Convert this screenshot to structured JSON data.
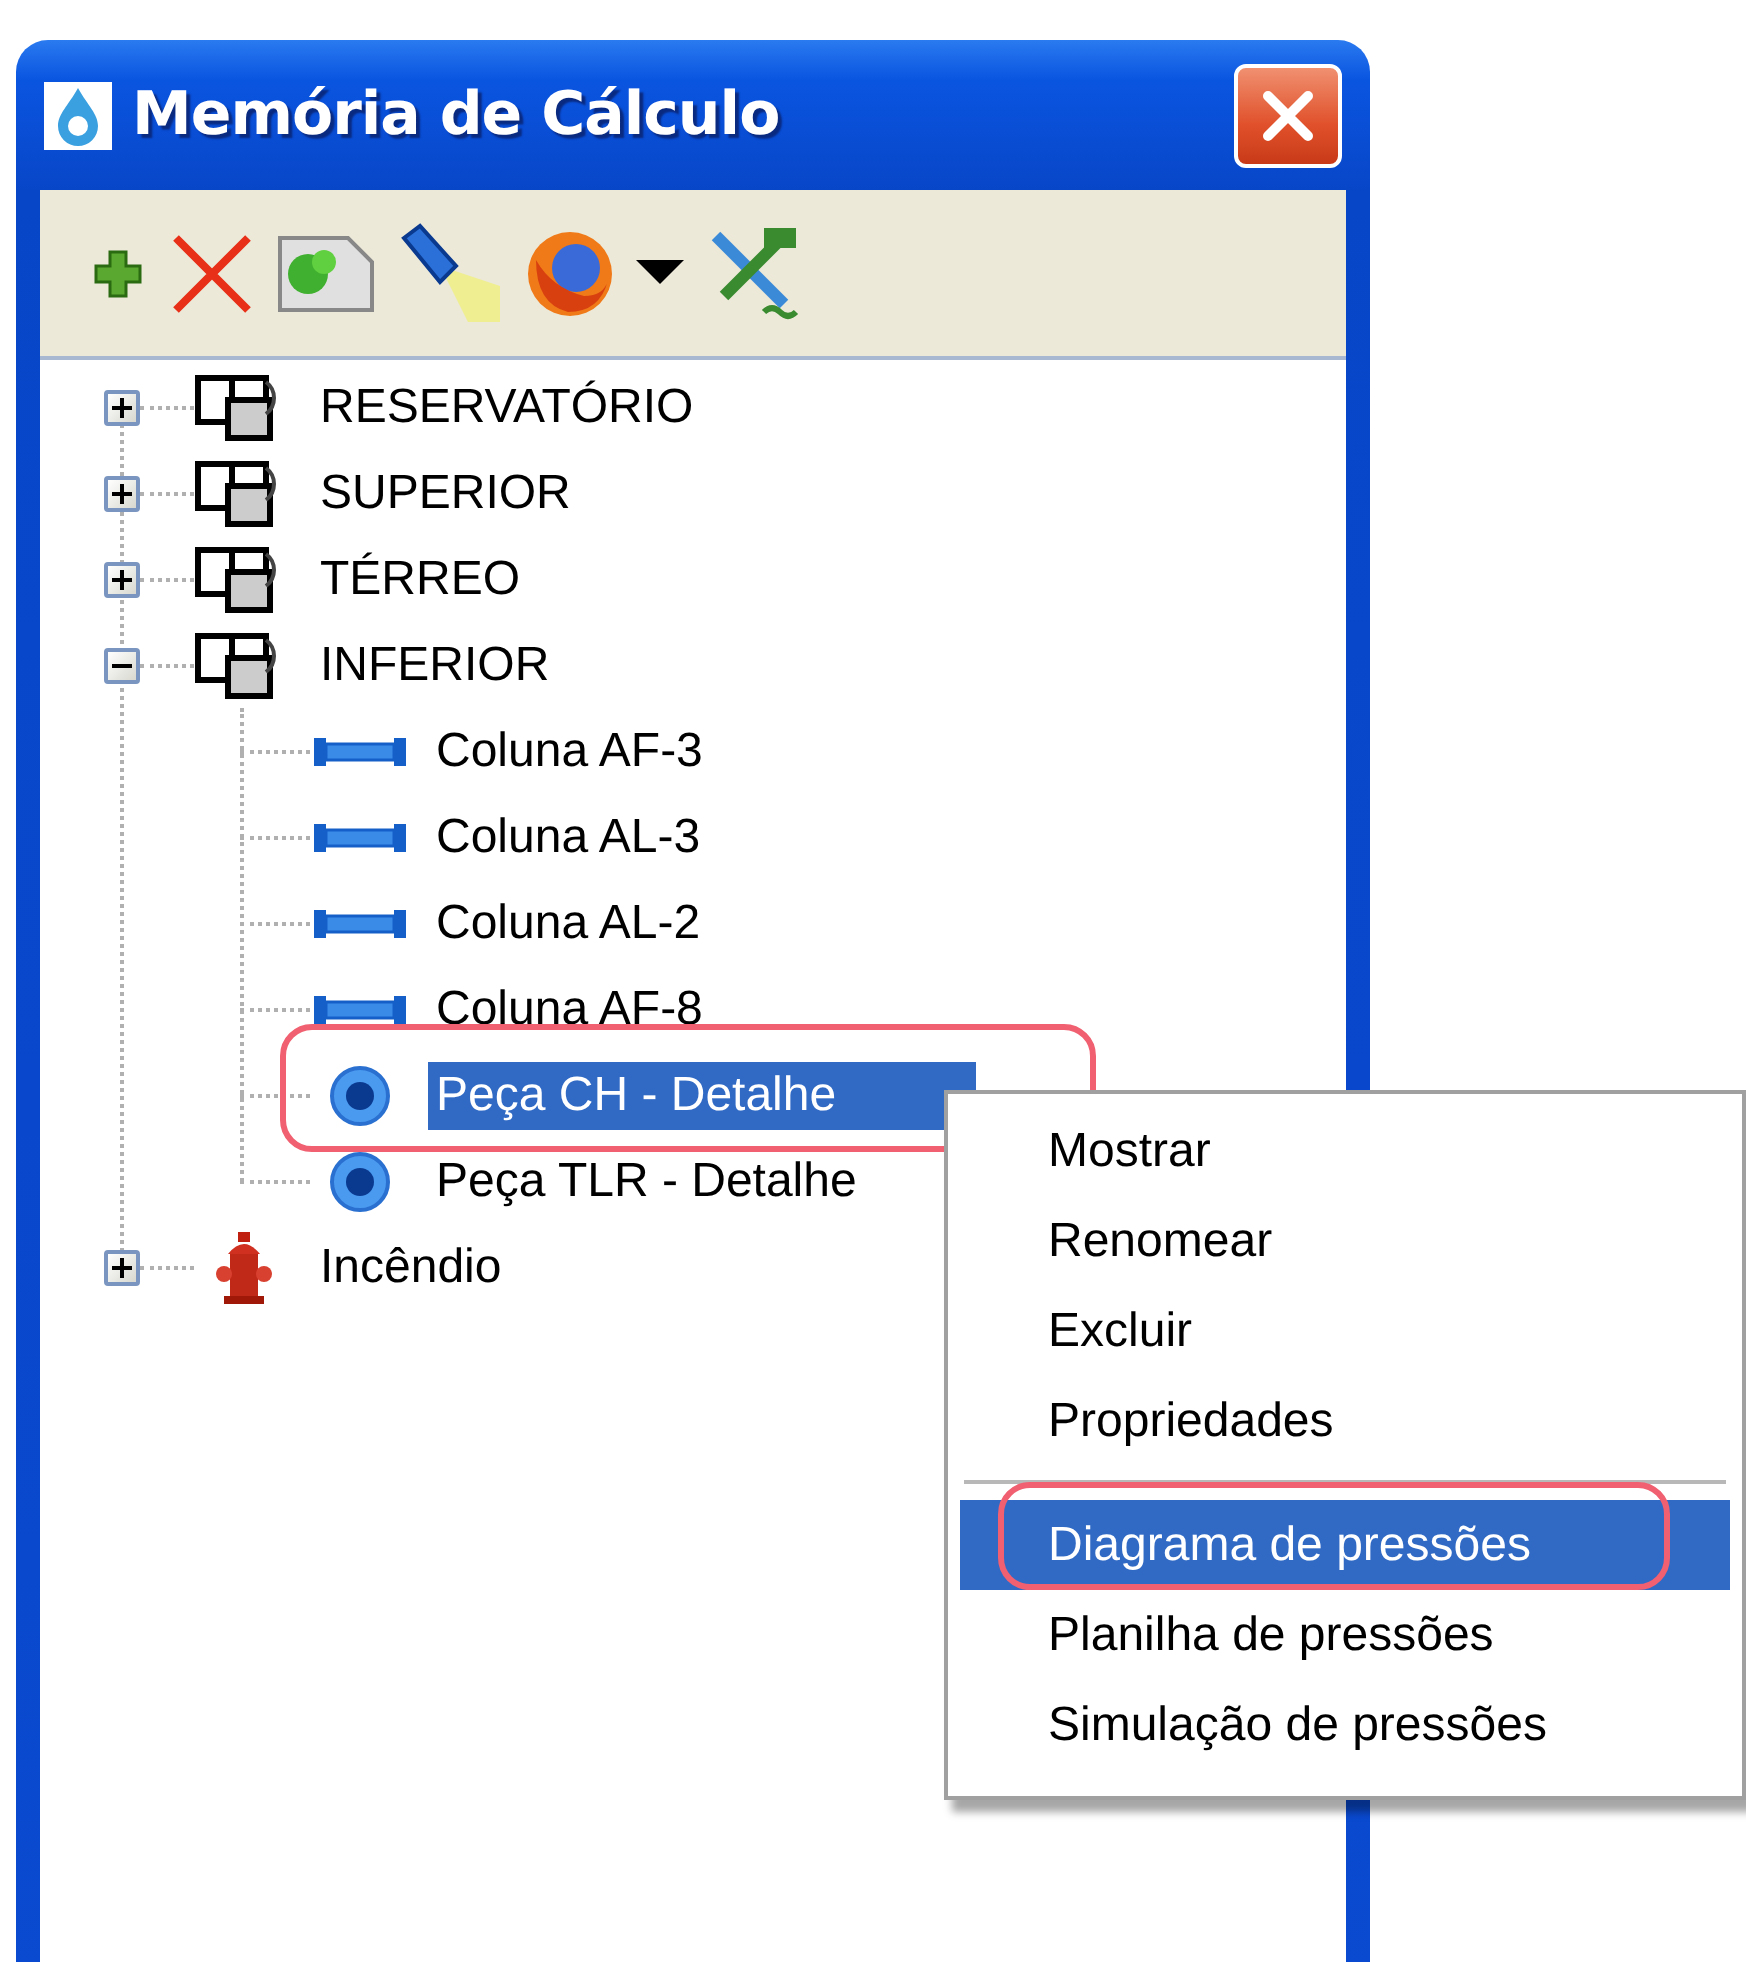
{
  "window": {
    "title": "Memória de Cálculo"
  },
  "tree": [
    {
      "label": "RESERVATÓRIO",
      "kind": "floor",
      "expanded": false,
      "selected": false,
      "annotated": false
    },
    {
      "label": "SUPERIOR",
      "kind": "floor",
      "expanded": false,
      "selected": false,
      "annotated": false
    },
    {
      "label": "TÉRREO",
      "kind": "floor",
      "expanded": false,
      "selected": false,
      "annotated": false
    },
    {
      "label": "INFERIOR",
      "kind": "floor",
      "expanded": true,
      "selected": false,
      "annotated": false,
      "children": [
        {
          "label": "Coluna AF-3",
          "kind": "column",
          "selected": false,
          "annotated": false
        },
        {
          "label": "Coluna AL-3",
          "kind": "column",
          "selected": false,
          "annotated": false
        },
        {
          "label": "Coluna AL-2",
          "kind": "column",
          "selected": false,
          "annotated": false
        },
        {
          "label": "Coluna AF-8",
          "kind": "column",
          "selected": false,
          "annotated": false
        },
        {
          "label": "Peça CH - Detalhe",
          "kind": "fitting",
          "selected": true,
          "annotated": true
        },
        {
          "label": "Peça TLR - Detalhe",
          "kind": "fitting",
          "selected": false,
          "annotated": false
        }
      ]
    },
    {
      "label": "Incêndio",
      "kind": "hydrant",
      "expanded": false,
      "selected": false,
      "annotated": false
    }
  ],
  "context_menu": {
    "groups": [
      [
        {
          "label": "Mostrar",
          "selected": false,
          "annotated": false
        },
        {
          "label": "Renomear",
          "selected": false,
          "annotated": false
        },
        {
          "label": "Excluir",
          "selected": false,
          "annotated": false
        },
        {
          "label": "Propriedades",
          "selected": false,
          "annotated": false
        }
      ],
      [
        {
          "label": "Diagrama de pressões",
          "selected": true,
          "annotated": true
        },
        {
          "label": "Planilha de pressões",
          "selected": false,
          "annotated": false
        },
        {
          "label": "Simulação de pressões",
          "selected": false,
          "annotated": false
        }
      ]
    ]
  }
}
